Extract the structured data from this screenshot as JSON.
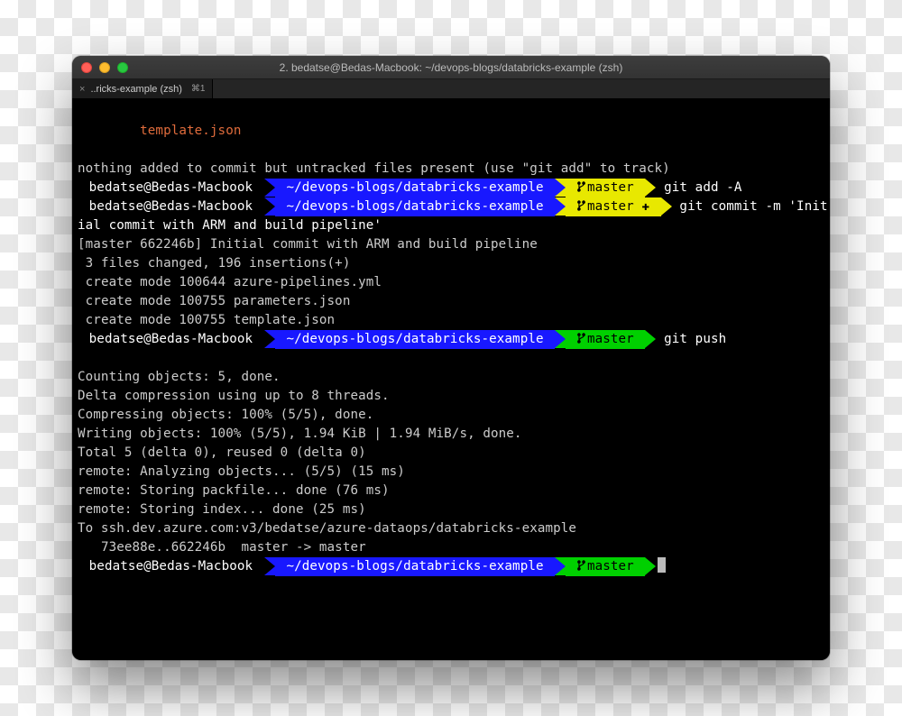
{
  "window": {
    "title": "2. bedatse@Bedas-Macbook: ~/devops-blogs/databricks-example (zsh)"
  },
  "tab": {
    "close": "×",
    "label": "..ricks-example (zsh)",
    "hint": "⌘1"
  },
  "prompt": {
    "user": "bedatse@Bedas-Macbook",
    "path": "~/devops-blogs/databricks-example",
    "branch": "master"
  },
  "lines": {
    "indent_file": "        template.json",
    "blank": "",
    "untracked": "nothing added to commit but untracked files present (use \"git add\" to track)",
    "cmd_add": " git add -A",
    "cmd_commit": " git commit -m 'Initial commit with ARM and build pipeline'",
    "commit_out1": "[master 662246b] Initial commit with ARM and build pipeline",
    "commit_out2": " 3 files changed, 196 insertions(+)",
    "commit_out3": " create mode 100644 azure-pipelines.yml",
    "commit_out4": " create mode 100755 parameters.json",
    "commit_out5": " create mode 100755 template.json",
    "cmd_push": " git push",
    "push1": "Counting objects: 5, done.",
    "push2": "Delta compression using up to 8 threads.",
    "push3": "Compressing objects: 100% (5/5), done.",
    "push4": "Writing objects: 100% (5/5), 1.94 KiB | 1.94 MiB/s, done.",
    "push5": "Total 5 (delta 0), reused 0 (delta 0)",
    "push6": "remote: Analyzing objects... (5/5) (15 ms)",
    "push7": "remote: Storing packfile... done (76 ms)",
    "push8": "remote: Storing index... done (25 ms)",
    "push9": "To ssh.dev.azure.com:v3/bedatse/azure-dataops/databricks-example",
    "push10": "   73ee88e..662246b  master -> master",
    "plus": "✚"
  }
}
